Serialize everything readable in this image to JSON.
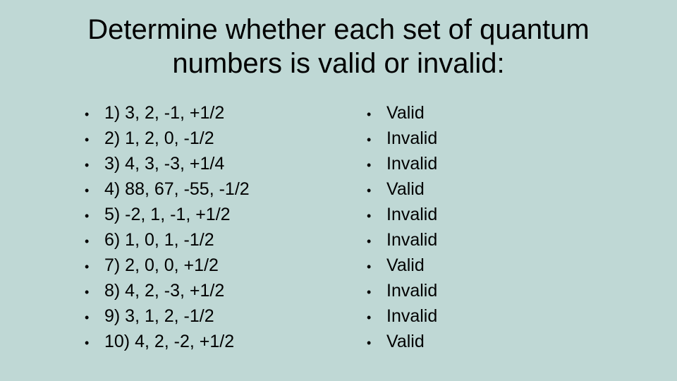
{
  "title": "Determine whether each set of quantum numbers is valid or invalid:",
  "questions": [
    "1)  3, 2, -1, +1/2",
    "2)  1, 2, 0, -1/2",
    "3)  4, 3, -3, +1/4",
    "4)  88, 67, -55, -1/2",
    "5)  -2, 1, -1, +1/2",
    "6)  1, 0, 1, -1/2",
    "7)  2, 0, 0, +1/2",
    "8)  4, 2, -3, +1/2",
    "9)  3, 1, 2, -1/2",
    "10) 4, 2, -2, +1/2"
  ],
  "answers": [
    "Valid",
    "Invalid",
    "Invalid",
    "Valid",
    "Invalid",
    "Invalid",
    "Valid",
    "Invalid",
    "Invalid",
    "Valid"
  ]
}
